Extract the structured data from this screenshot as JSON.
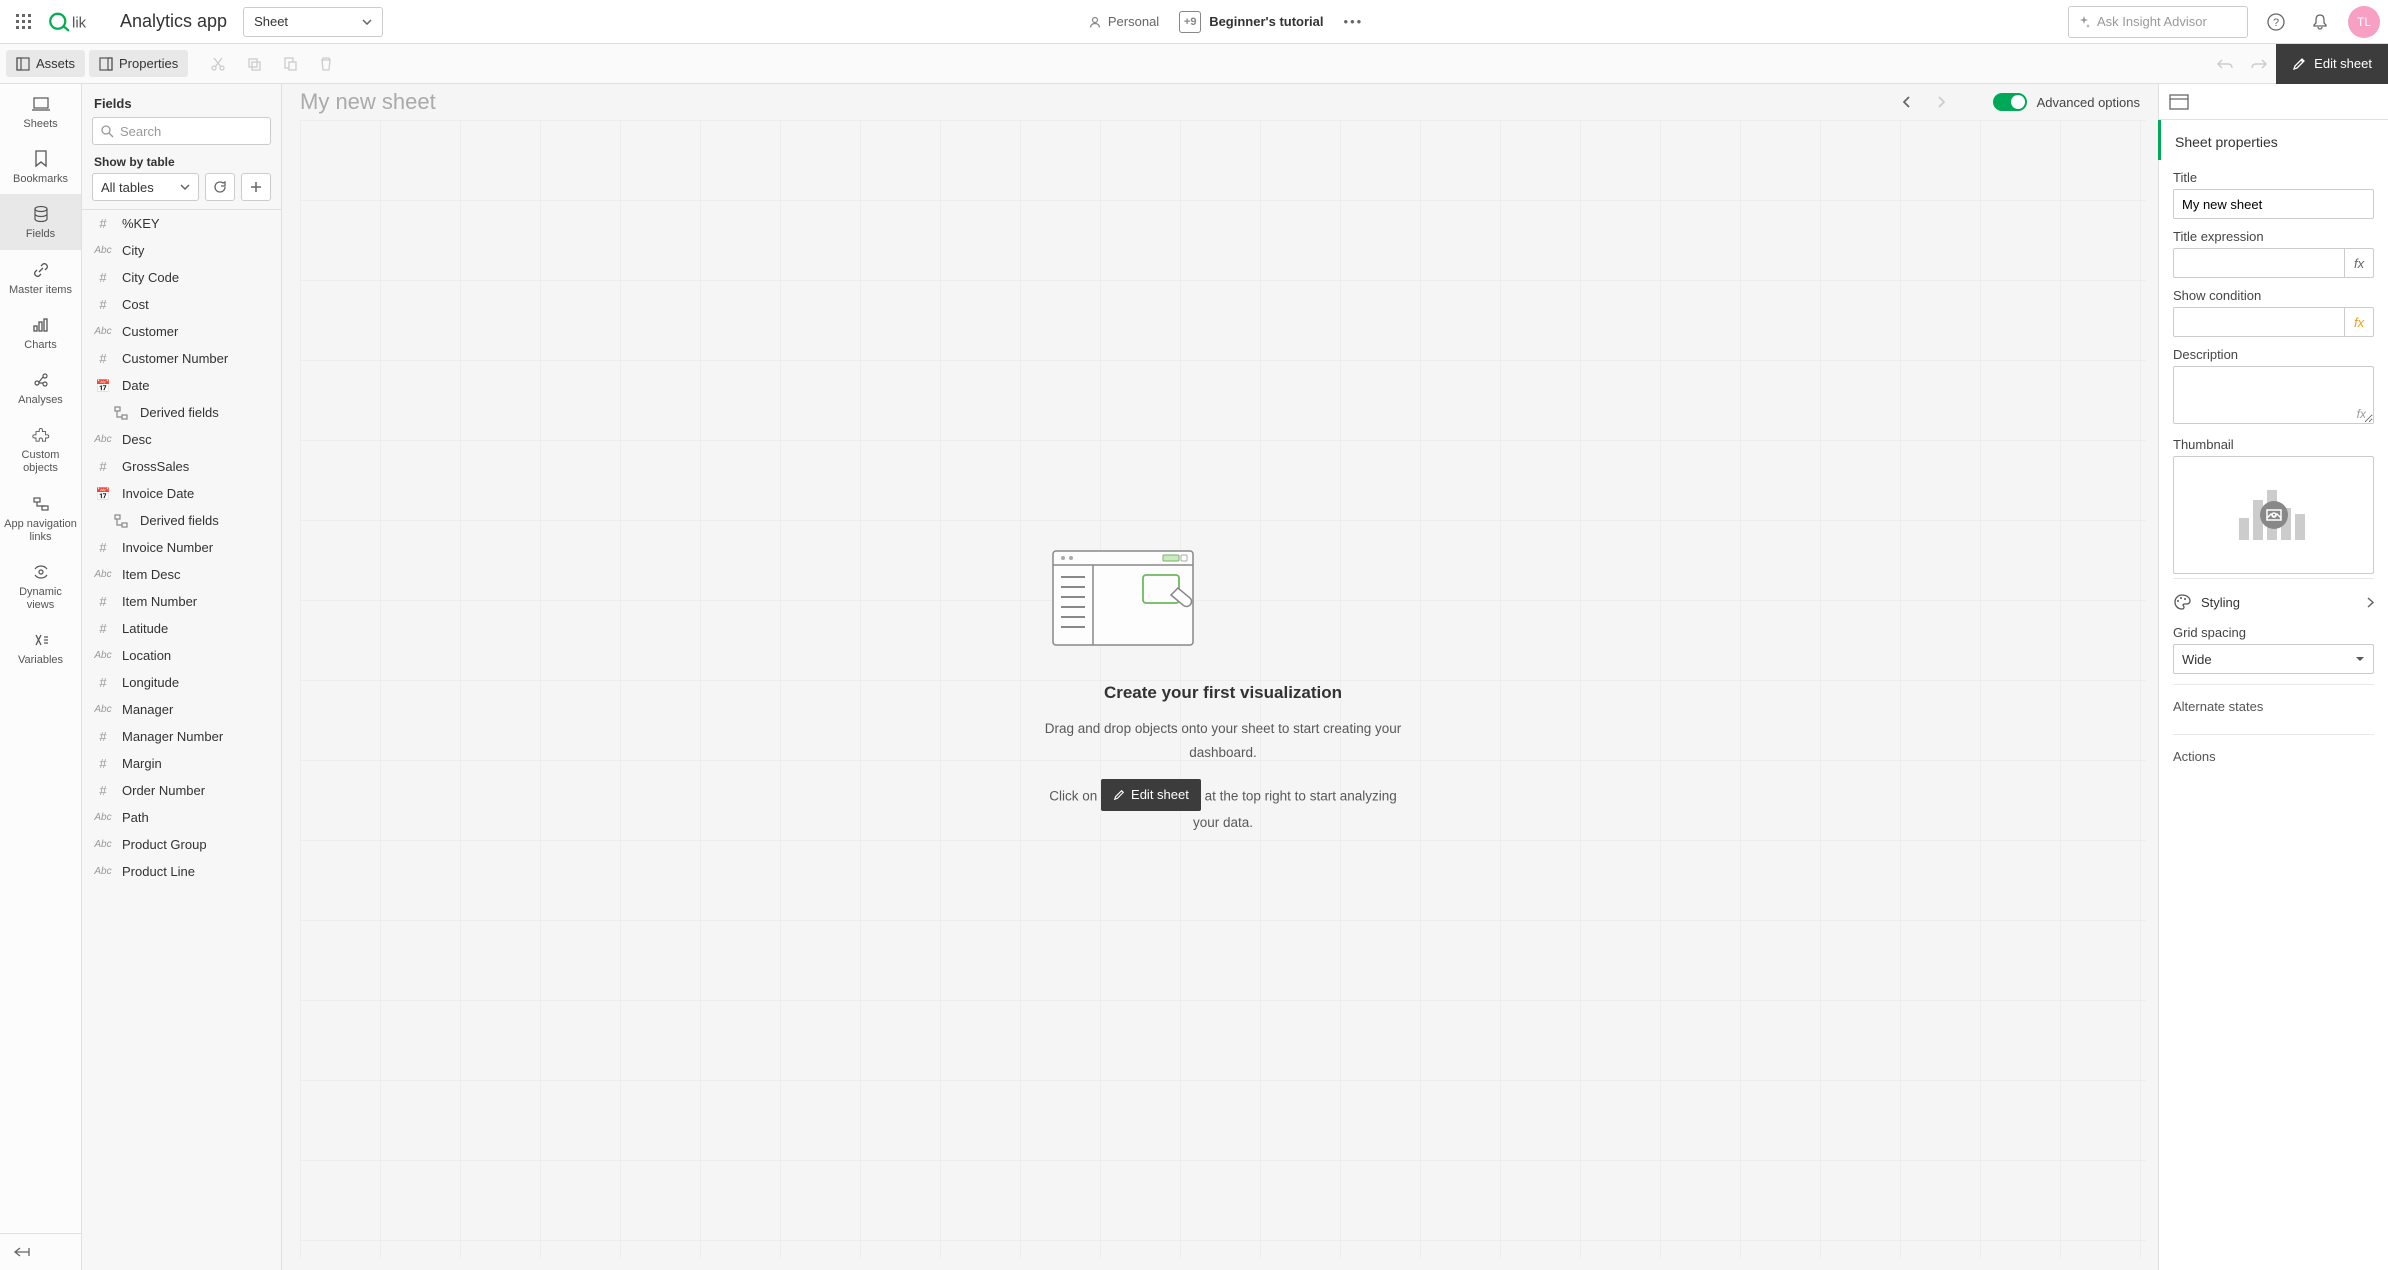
{
  "header": {
    "app_title": "Analytics app",
    "sheet_dropdown": "Sheet",
    "personal": "Personal",
    "tutorial_icon": "+9",
    "tutorial": "Beginner's tutorial",
    "insight_placeholder": "Ask Insight Advisor",
    "avatar": "TL"
  },
  "toolbar": {
    "assets": "Assets",
    "properties": "Properties",
    "edit_sheet": "Edit sheet"
  },
  "left_sidebar": {
    "items": [
      {
        "label": "Sheets"
      },
      {
        "label": "Bookmarks"
      },
      {
        "label": "Fields"
      },
      {
        "label": "Master items"
      },
      {
        "label": "Charts"
      },
      {
        "label": "Analyses"
      },
      {
        "label": "Custom objects"
      },
      {
        "label": "App navigation links"
      },
      {
        "label": "Dynamic views"
      },
      {
        "label": "Variables"
      }
    ]
  },
  "fields_panel": {
    "title": "Fields",
    "search_placeholder": "Search",
    "show_by_table": "Show by table",
    "all_tables": "All tables",
    "items": [
      {
        "type": "num",
        "name": "%KEY"
      },
      {
        "type": "abc",
        "name": "City"
      },
      {
        "type": "num",
        "name": "City Code"
      },
      {
        "type": "num",
        "name": "Cost"
      },
      {
        "type": "abc",
        "name": "Customer"
      },
      {
        "type": "num",
        "name": "Customer Number"
      },
      {
        "type": "date",
        "name": "Date"
      },
      {
        "type": "tree",
        "name": "Derived fields",
        "derived": true
      },
      {
        "type": "abc",
        "name": "Desc"
      },
      {
        "type": "num",
        "name": "GrossSales"
      },
      {
        "type": "date",
        "name": "Invoice Date"
      },
      {
        "type": "tree",
        "name": "Derived fields",
        "derived": true
      },
      {
        "type": "num",
        "name": "Invoice Number"
      },
      {
        "type": "abc",
        "name": "Item Desc"
      },
      {
        "type": "num",
        "name": "Item Number"
      },
      {
        "type": "num",
        "name": "Latitude"
      },
      {
        "type": "abc",
        "name": "Location"
      },
      {
        "type": "num",
        "name": "Longitude"
      },
      {
        "type": "abc",
        "name": "Manager"
      },
      {
        "type": "num",
        "name": "Manager Number"
      },
      {
        "type": "num",
        "name": "Margin"
      },
      {
        "type": "num",
        "name": "Order Number"
      },
      {
        "type": "abc",
        "name": "Path"
      },
      {
        "type": "abc",
        "name": "Product Group"
      },
      {
        "type": "abc",
        "name": "Product Line"
      }
    ]
  },
  "canvas": {
    "sheet_title": "My new sheet",
    "advanced_options": "Advanced options",
    "empty_title": "Create your first visualization",
    "empty_line1": "Drag and drop objects onto your sheet to start creating your dashboard.",
    "empty_line2a": "Click on",
    "empty_line2_btn": "Edit sheet",
    "empty_line2b": "at the top right to start analyzing your data."
  },
  "right_panel": {
    "section_title": "Sheet properties",
    "title_label": "Title",
    "title_value": "My new sheet",
    "title_expression_label": "Title expression",
    "show_condition_label": "Show condition",
    "description_label": "Description",
    "thumbnail_label": "Thumbnail",
    "styling_label": "Styling",
    "grid_spacing_label": "Grid spacing",
    "grid_spacing_value": "Wide",
    "alternate_states_label": "Alternate states",
    "actions_label": "Actions"
  }
}
